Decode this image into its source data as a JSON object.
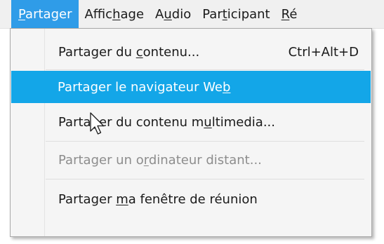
{
  "menubar": {
    "items": [
      {
        "name": "Partager",
        "pre": "",
        "u": "P",
        "post": "artager",
        "active": true
      },
      {
        "name": "Affichage",
        "pre": "Affic",
        "u": "h",
        "post": "age",
        "active": false
      },
      {
        "name": "Audio",
        "pre": "A",
        "u": "u",
        "post": "dio",
        "active": false
      },
      {
        "name": "Participant",
        "pre": "Par",
        "u": "t",
        "post": "icipant",
        "active": false
      },
      {
        "name": "Réunion",
        "pre": "",
        "u": "R",
        "post": "é",
        "active": false
      }
    ]
  },
  "dropdown": {
    "items": [
      {
        "pre": "Partager du ",
        "u": "c",
        "post": "ontenu...",
        "shortcut": "Ctrl+Alt+D",
        "state": "normal"
      },
      {
        "pre": "Partager le navigateur We",
        "u": "b",
        "post": "",
        "shortcut": "",
        "state": "highlighted"
      },
      {
        "pre": "Partager du contenu m",
        "u": "u",
        "post": "ltimedia...",
        "shortcut": "",
        "state": "normal"
      },
      {
        "pre": "Partager un o",
        "u": "r",
        "post": "dinateur distant...",
        "shortcut": "",
        "state": "disabled"
      },
      {
        "pre": "Partager ",
        "u": "m",
        "post": "a fenêtre de réunion",
        "shortcut": "",
        "state": "normal"
      }
    ]
  },
  "colors": {
    "menubar_active": "#2f9ce8",
    "item_highlight": "#13a6e8",
    "disabled_text": "#8d8d8d"
  },
  "icons": {
    "cursor": "mouse-pointer-icon"
  }
}
